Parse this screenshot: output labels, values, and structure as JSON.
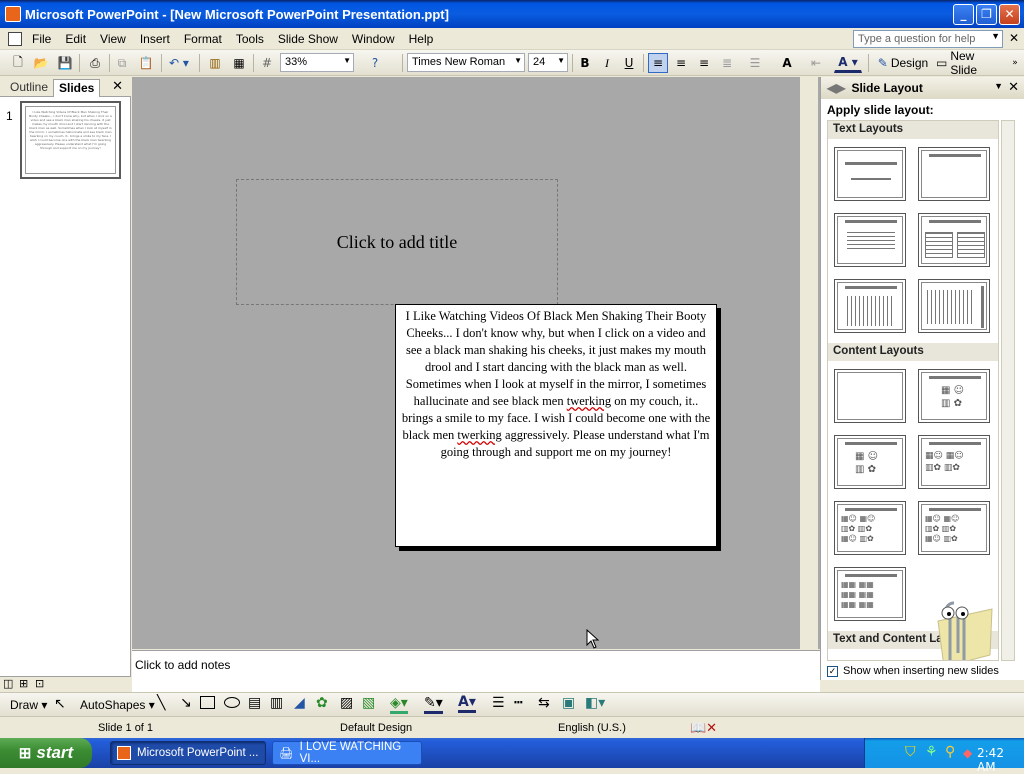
{
  "window": {
    "title": "Microsoft PowerPoint - [New Microsoft PowerPoint Presentation.ppt]"
  },
  "menu": {
    "items": [
      "File",
      "Edit",
      "View",
      "Insert",
      "Format",
      "Tools",
      "Slide Show",
      "Window",
      "Help"
    ],
    "ask_placeholder": "Type a question for help"
  },
  "toolbar": {
    "zoom": "33%",
    "font": "Times New Roman",
    "size": "24",
    "bold": "B",
    "italic": "I",
    "underline": "U",
    "design": "Design",
    "new_slide": "New Slide"
  },
  "left_pane": {
    "tab_outline": "Outline",
    "tab_slides": "Slides",
    "slide_number": "1"
  },
  "slide": {
    "title_placeholder": "Click to add title",
    "body_before1": "I Like Watching Videos Of Black Men Shaking Their Booty Cheeks... I don't know why, but when I click on a video and see a black man shaking his cheeks, it just makes my mouth drool and I start dancing with the black man as well. Sometimes when I look at myself in the mirror, I sometimes hallucinate and see black men ",
    "body_word1": "twerking",
    "body_mid": " on my couch, it.. brings a smile to my face. I wish I could become one with the black men ",
    "body_word2": "twerking",
    "body_after": " aggressively. Please understand what I'm going through and support me on my journey!"
  },
  "notes": {
    "placeholder": "Click to add notes"
  },
  "task_pane": {
    "title": "Slide Layout",
    "apply": "Apply slide layout:",
    "sections": [
      "Text Layouts",
      "Content Layouts",
      "Text and Content Layouts"
    ],
    "show_when_inserting": "Show when inserting new slides",
    "checked": "✓"
  },
  "drawbar": {
    "draw": "Draw",
    "autoshapes": "AutoShapes"
  },
  "status": {
    "slide": "Slide 1 of 1",
    "design": "Default Design",
    "language": "English (U.S.)"
  },
  "taskbar": {
    "start": "start",
    "btn1": "Microsoft PowerPoint ...",
    "btn2": "I LOVE WATCHING VI...",
    "time": "2:42 AM"
  },
  "colors": {
    "title_bar": "#0a5ce0",
    "slide_bg": "#a8a8a8",
    "taskbar": "#245edb",
    "start": "#3c8d34"
  }
}
